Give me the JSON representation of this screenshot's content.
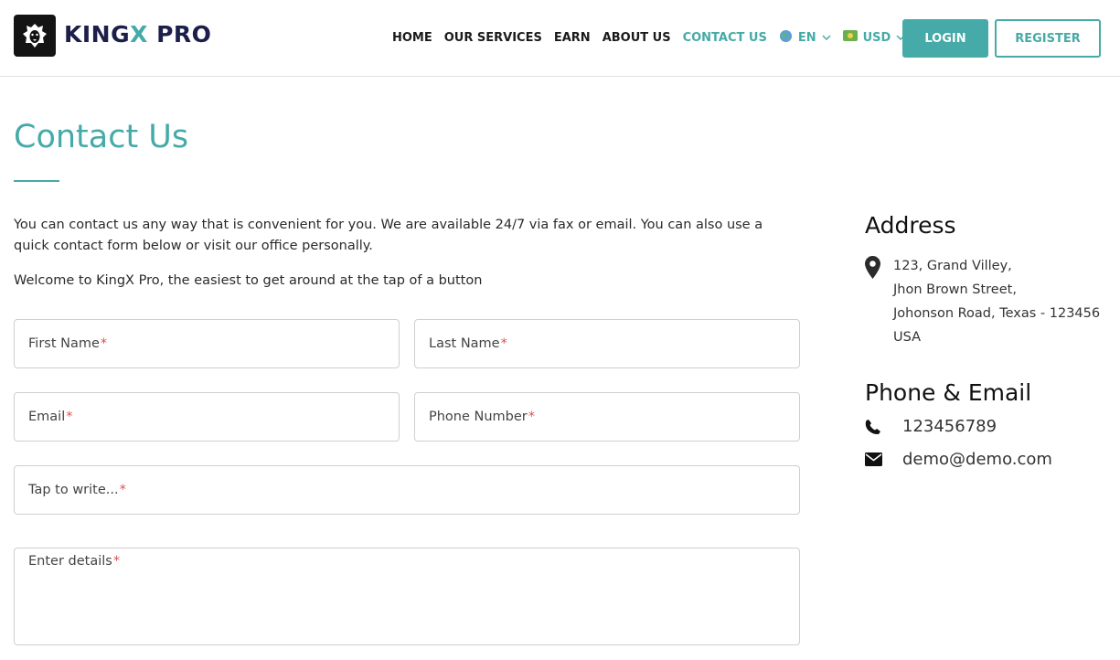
{
  "brand": {
    "prefix": "KING",
    "x": "X",
    "suffix": " PRO"
  },
  "nav": {
    "items": [
      "HOME",
      "OUR SERVICES",
      "EARN",
      "ABOUT US",
      "CONTACT US"
    ],
    "active": "CONTACT US",
    "language": "EN",
    "currency": "USD"
  },
  "buttons": {
    "login": "LOGIN",
    "register": "REGISTER"
  },
  "page": {
    "title": "Contact Us",
    "intro": "You can contact us any way that is convenient for you. We are available 24/7 via fax or email. You can also use a quick contact form below or visit our office personally.",
    "welcome": "Welcome to KingX Pro, the easiest to get around at the tap of a button"
  },
  "form": {
    "first_name": "First Name",
    "last_name": "Last Name",
    "email": "Email",
    "phone": "Phone Number",
    "subject": "Tap to write...",
    "details": "Enter details",
    "required_mark": "*"
  },
  "sidebar": {
    "address_heading": "Address",
    "address_lines": [
      "123, Grand Villey,",
      "Jhon Brown Street,",
      "Johonson Road, Texas - 123456",
      "USA"
    ],
    "contact_heading": "Phone & Email",
    "phone": "123456789",
    "email": "demo@demo.com"
  },
  "colors": {
    "accent": "#46aaa8",
    "brand_dark": "#1c1f4a",
    "required": "#d9534f"
  },
  "icons": [
    "lion-logo-icon",
    "globe-icon",
    "flag-icon",
    "chevron-down-icon",
    "map-pin-icon",
    "phone-icon",
    "envelope-icon"
  ]
}
